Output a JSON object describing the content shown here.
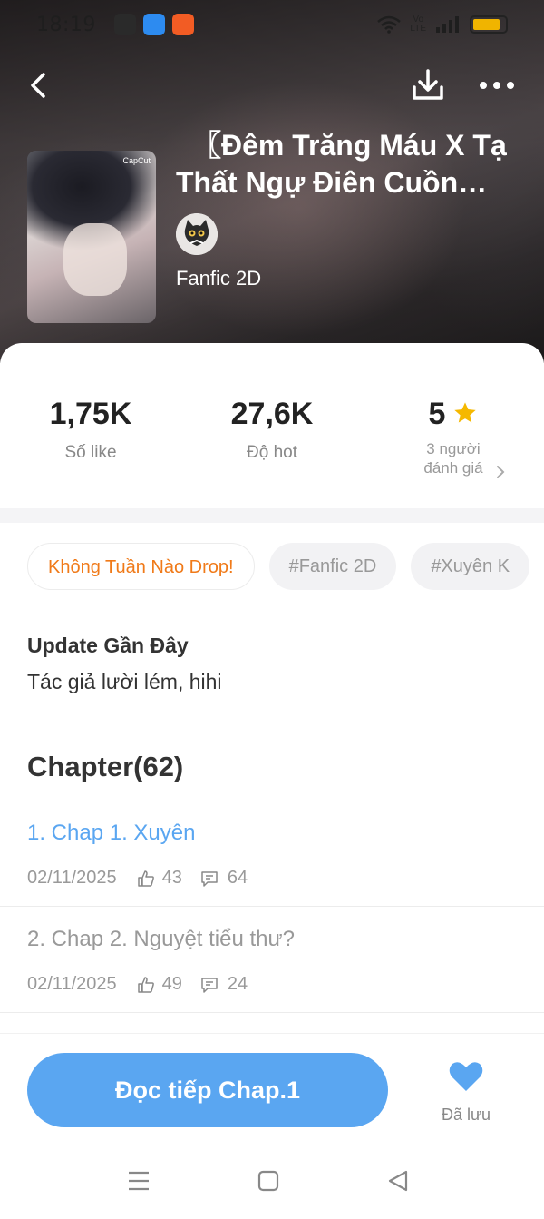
{
  "status_bar": {
    "time": "18:19",
    "network_label_top": "Vo",
    "network_label_bottom": "LTE",
    "battery_level": 0.85,
    "app_icons": [
      "app-icon",
      "app-icon",
      "app-icon"
    ]
  },
  "nav": {
    "back_icon": "chevron-left-icon",
    "download_icon": "download-icon",
    "more_icon": "more-icon"
  },
  "book": {
    "title_line1": "〖Đêm Trăng Máu X Tạ",
    "title_line2": "Thất Ngự Điên Cuồng ...",
    "cover_mark": "CapCut",
    "author": "Fanfic 2D"
  },
  "stats": {
    "likes_value": "1,75K",
    "likes_label": "Số like",
    "hot_value": "27,6K",
    "hot_label": "Độ hot",
    "rating_value": "5",
    "rating_label_line1": "3 người",
    "rating_label_line2": "đánh giá"
  },
  "tags": [
    "Không Tuần Nào Drop!",
    "#Fanfic 2D",
    "#Xuyên K"
  ],
  "update": {
    "title": "Update Gần Đây",
    "text": "Tác giả lười lém, hihi"
  },
  "chapters": {
    "heading": "Chapter(62)",
    "items": [
      {
        "title": "1. Chap 1. Xuyên",
        "date": "02/11/2025",
        "likes": "43",
        "comments": "64",
        "active": true
      },
      {
        "title": "2. Chap 2. Nguyệt tiểu thư?",
        "date": "02/11/2025",
        "likes": "49",
        "comments": "24",
        "active": false
      }
    ]
  },
  "actions": {
    "read_button": "Đọc tiếp Chap.1",
    "saved_label": "Đã lưu"
  },
  "colors": {
    "accent_blue": "#5aa6f1",
    "active_chapter": "#5aa6f1",
    "tag_orange": "#f07a19",
    "star": "#f5b800"
  }
}
